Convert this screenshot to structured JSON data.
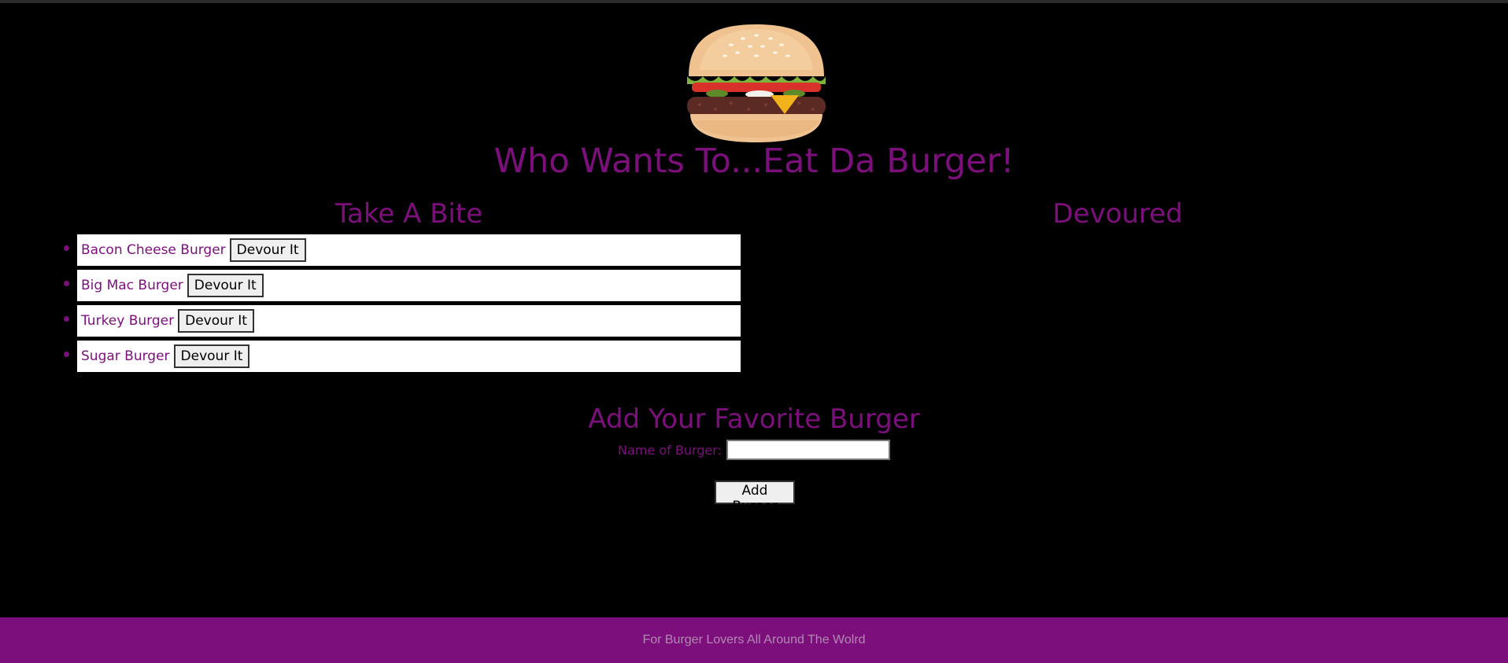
{
  "header": {
    "logo_icon": "hamburger-icon",
    "title": "Who Wants To...Eat Da Burger!"
  },
  "columns": {
    "left_heading": "Take A Bite",
    "right_heading": "Devoured"
  },
  "burgers": [
    {
      "name": "Bacon Cheese Burger",
      "button_label": "Devour It"
    },
    {
      "name": "Big Mac Burger",
      "button_label": "Devour It"
    },
    {
      "name": "Turkey Burger",
      "button_label": "Devour It"
    },
    {
      "name": "Sugar Burger",
      "button_label": "Devour It"
    }
  ],
  "devoured": [],
  "add_form": {
    "heading": "Add Your Favorite Burger",
    "label": "Name of Burger:",
    "input_value": "",
    "submit_label": "Add Burger"
  },
  "footer": {
    "text": "For Burger Lovers All Around The Wolrd"
  },
  "colors": {
    "accent": "#7d0f7d",
    "background": "#000000",
    "item_background": "#ffffff"
  }
}
